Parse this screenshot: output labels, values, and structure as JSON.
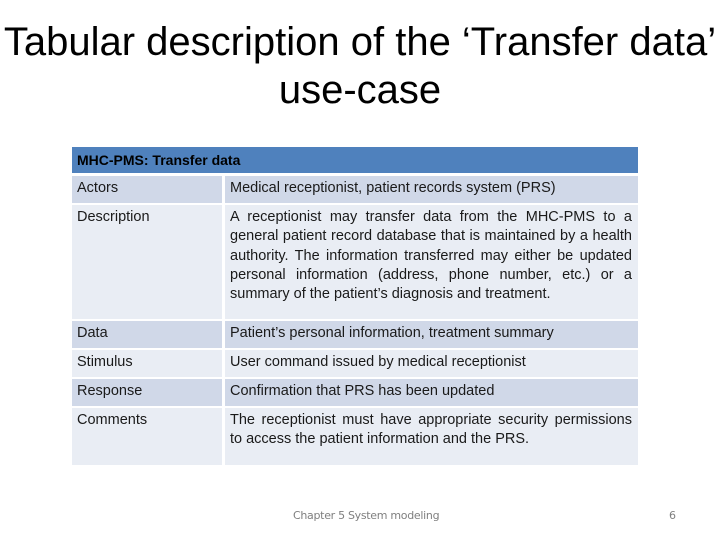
{
  "slide": {
    "title": "Tabular description of the ‘Transfer data’ use-case"
  },
  "table": {
    "header": "MHC-PMS: Transfer data",
    "rows": [
      {
        "label": "Actors",
        "value": "Medical receptionist, patient records system (PRS)"
      },
      {
        "label": "Description",
        "value": "A receptionist may transfer data from the MHC-PMS to a general patient record database that is maintained by a health authority. The information transferred may either be updated personal information (address, phone number, etc.) or a summary of the patient’s diagnosis and treatment."
      },
      {
        "label": "Data",
        "value": "Patient’s personal information, treatment summary"
      },
      {
        "label": "Stimulus",
        "value": "User command issued by medical receptionist"
      },
      {
        "label": "Response",
        "value": "Confirmation that PRS has been updated"
      },
      {
        "label": "Comments",
        "value": "The receptionist must have appropriate security permissions to access the patient information and the PRS."
      }
    ]
  },
  "footer": {
    "text": "Chapter 5 System modeling",
    "page_number": "6"
  },
  "colors": {
    "header_bg": "#4f81bd",
    "row_dark": "#d0d8e8",
    "row_light": "#e9edf4"
  }
}
